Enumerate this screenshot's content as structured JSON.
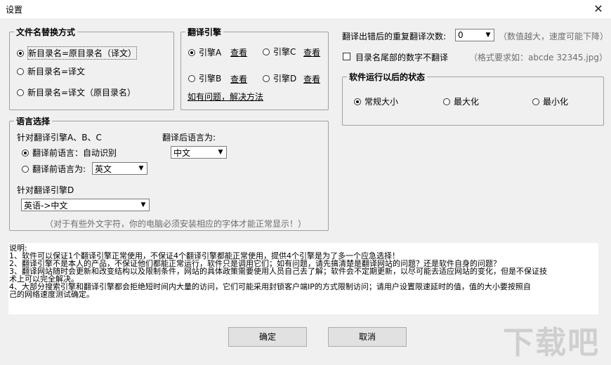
{
  "window": {
    "title": "设置",
    "close_glyph": "✕"
  },
  "rename_group": {
    "legend": "文件名替换方式",
    "options": [
      "新目录名=原目录名（译文）",
      "新目录名=译文",
      "新目录名=译文（原目录名）"
    ],
    "selected": 0
  },
  "engine_group": {
    "legend": "翻译引擎",
    "engines": [
      "引擎A",
      "引擎C",
      "引擎B",
      "引擎D"
    ],
    "selected": 0,
    "view_label": "查看",
    "help_link": "如有问题，解决方法"
  },
  "retry": {
    "label": "翻译出错后的重复翻译次数:",
    "value": "0",
    "hint": "（数值越大，速度可能下降）"
  },
  "trailing_digits": {
    "label": "目录名尾部的数字不翻译",
    "checked": false,
    "hint": "（格式要求如：abcde 32345.jpg）"
  },
  "run_state_group": {
    "legend": "软件运行以后的状态",
    "options": [
      "常规大小",
      "最大化",
      "最小化"
    ],
    "selected": 0
  },
  "language_group": {
    "legend": "语言选择",
    "abc_label": "针对翻译引擎A、B、C",
    "auto_label": "翻译前语言：自动识别",
    "source_label": "翻译前语言为:",
    "source_value": "英文",
    "target_label": "翻译后语言为:",
    "target_value": "中文",
    "d_label": "针对翻译引擎D",
    "d_value": "英语->中文",
    "selected": 0,
    "font_note": "（对于有些外文字符，你的电脑必须安装相应的字体才能正常显示！）"
  },
  "notes": {
    "lines": [
      "说明:",
      "1、软件可以保证1个翻译引擎正常使用，不保证4个翻译引擎都能正常使用，提供4个引擎是为了多一个应急选择！",
      "2、翻译引擎不是本人的产品，不保证他们都能正常运行，软件只是调用它们；如有问题，请先搞清楚是翻译网站的问题？还是软件自身的问题？",
      "3、翻译网站随时会更新和改变结构以及限制条件，网站的具体政策需要使用人员自己去了解；软件会不定期更新，以尽可能去适应网站的变化，但是不保证技",
      "术上可以完全解决。",
      "4、大部分搜索引擎和翻译引擎都会拒绝短时间内大量的访问，它们可能采用封锁客户端IP的方式限制访问；请用户设置限速延时的值，值的大小要按照自",
      "己的网络速度测试确定。"
    ]
  },
  "buttons": {
    "ok": "确定",
    "cancel": "取消"
  },
  "watermark": {
    "text": "下载吧"
  },
  "icons": {
    "dropdown": "dropdown-arrow-icon",
    "close": "close-icon"
  }
}
